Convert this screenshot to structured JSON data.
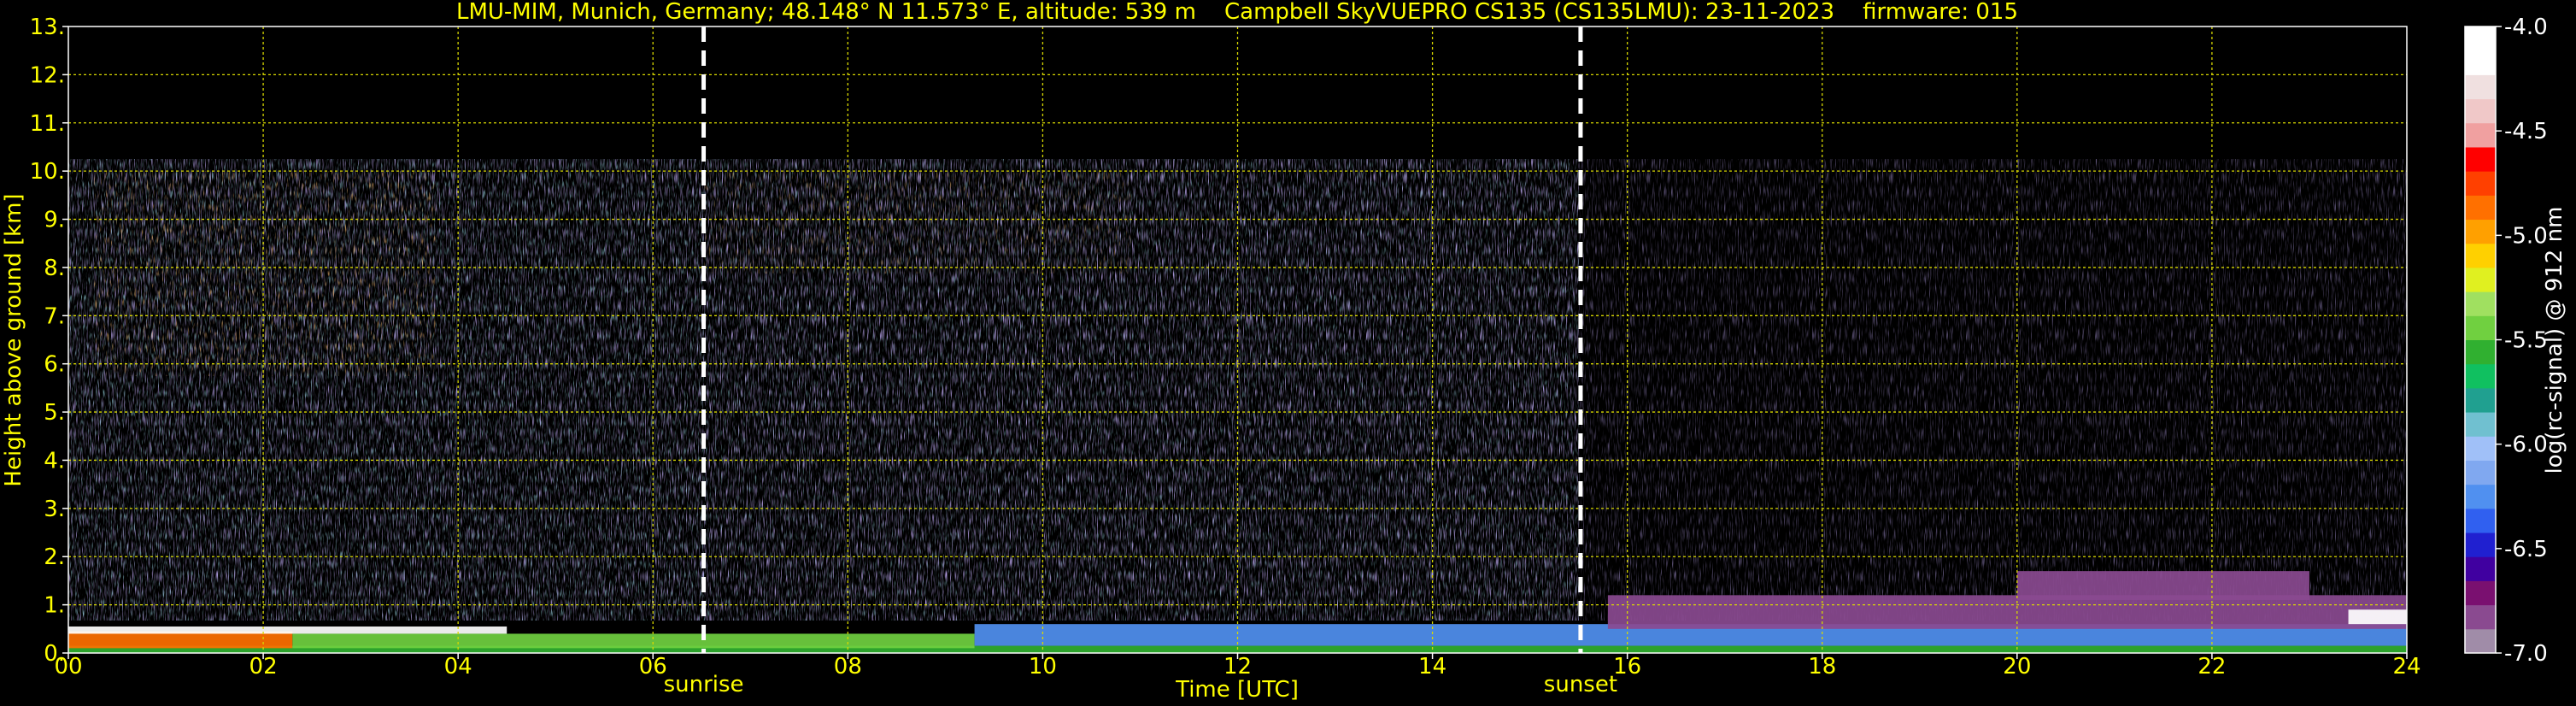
{
  "chart_data": {
    "type": "heatmap",
    "title": "LMU-MIM, Munich, Germany; 48.148° N 11.573° E, altitude: 539 m    Campbell SkyVUEPRO CS135 (CS135LMU): 23-11-2023    firmware: 015",
    "xlabel": "Time [UTC]",
    "ylabel": "Height above ground [km]",
    "xlim": [
      0,
      24
    ],
    "ylim": [
      0,
      13
    ],
    "x_ticks": [
      "00",
      "02",
      "04",
      "06",
      "08",
      "10",
      "12",
      "14",
      "16",
      "18",
      "20",
      "22",
      "24"
    ],
    "y_ticks": [
      "0.",
      "1.",
      "2.",
      "3.",
      "4.",
      "5.",
      "6.",
      "7.",
      "8.",
      "9.",
      "10.",
      "11.",
      "12.",
      "13."
    ],
    "grid": true,
    "events": [
      {
        "label": "sunrise",
        "time": 6.52
      },
      {
        "label": "sunset",
        "time": 15.52
      }
    ],
    "colorbar": {
      "label": "log(rc-signal) @ 912 nm",
      "range": [
        -7.0,
        -4.0
      ],
      "ticks": [
        "-4.0",
        "-4.5",
        "-5.0",
        "-5.5",
        "-6.0",
        "-6.5",
        "-7.0"
      ],
      "tick_values": [
        -4.0,
        -4.5,
        -5.0,
        -5.5,
        -6.0,
        -6.5,
        -7.0
      ],
      "colors": [
        "#a08ca8",
        "#8a4a90",
        "#7a1070",
        "#4000a0",
        "#2020d0",
        "#3060f0",
        "#5090f0",
        "#80a8f0",
        "#a0c0f8",
        "#70c0d0",
        "#20a090",
        "#10c060",
        "#30b030",
        "#70d040",
        "#a0e060",
        "#e0f020",
        "#ffd000",
        "#ffa000",
        "#ff7000",
        "#ff4000",
        "#ff0000",
        "#f0a0a0",
        "#f0c8c8",
        "#f0e0e0",
        "#ffffff",
        "#ffffff"
      ]
    },
    "signal_regions": [
      {
        "t0": 0,
        "t1": 24,
        "h0": 0,
        "h1": 0.15,
        "value": -5.6
      },
      {
        "t0": 0,
        "t1": 2.3,
        "h0": 0.1,
        "h1": 0.45,
        "value": -4.9
      },
      {
        "t0": 2.3,
        "t1": 9.3,
        "h0": 0.1,
        "h1": 0.4,
        "value": -5.5
      },
      {
        "t0": 0,
        "t1": 4.5,
        "h0": 0.4,
        "h1": 0.55,
        "value": -4.2
      },
      {
        "t0": 9.3,
        "t1": 24,
        "h0": 0.15,
        "h1": 0.6,
        "value": -6.3
      },
      {
        "t0": 15.8,
        "t1": 24,
        "h0": 0.5,
        "h1": 1.2,
        "value": -6.8
      },
      {
        "t0": 20.0,
        "t1": 23.0,
        "h0": 1.1,
        "h1": 1.7,
        "value": -6.8
      },
      {
        "t0": 23.4,
        "t1": 24,
        "h0": 0.6,
        "h1": 0.9,
        "value": -4.0
      }
    ]
  }
}
